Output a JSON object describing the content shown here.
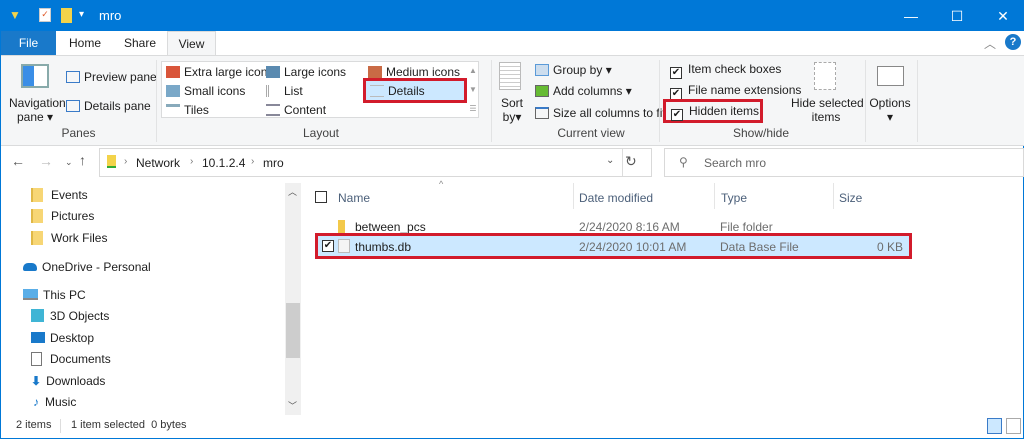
{
  "title": "mro",
  "window_buttons": {
    "minimize": "—",
    "maximize": "☐",
    "close": "✕"
  },
  "tabs": [
    "File",
    "Home",
    "Share",
    "View"
  ],
  "ribbon": {
    "panes": {
      "navigation_pane": "Navigation",
      "navigation_pane2": "pane",
      "preview_pane": "Preview pane",
      "details_pane": "Details pane",
      "group": "Panes"
    },
    "layout": {
      "items": [
        "Extra large icons",
        "Large icons",
        "Medium icons",
        "Small icons",
        "List",
        "Details",
        "Tiles",
        "Content"
      ],
      "selected": "Details",
      "group": "Layout"
    },
    "current_view": {
      "sort_by": "Sort",
      "sort_by2": "by",
      "group_by": "Group by",
      "add_columns": "Add columns",
      "size_columns": "Size all columns to fit",
      "group": "Current view"
    },
    "show_hide": {
      "item_check_boxes": "Item check boxes",
      "file_name_extensions": "File name extensions",
      "hidden_items": "Hidden items",
      "hide_selected": "Hide selected",
      "hide_selected2": "items",
      "group": "Show/hide",
      "checked": [
        true,
        true,
        true
      ]
    },
    "options": "Options"
  },
  "address": {
    "crumbs": [
      "Network",
      "10.1.2.4",
      "mro"
    ],
    "search_placeholder": "Search mro"
  },
  "nav": {
    "items": [
      "Events",
      "Pictures",
      "Work Files",
      "OneDrive - Personal",
      "This PC",
      "3D Objects",
      "Desktop",
      "Documents",
      "Downloads",
      "Music"
    ]
  },
  "columns": [
    "Name",
    "Date modified",
    "Type",
    "Size"
  ],
  "files": [
    {
      "name": "between_pcs",
      "date": "2/24/2020 8:16 AM",
      "type": "File folder",
      "size": "",
      "selected": false
    },
    {
      "name": "thumbs.db",
      "date": "2/24/2020 10:01 AM",
      "type": "Data Base File",
      "size": "0 KB",
      "selected": true
    }
  ],
  "status": {
    "count": "2 items",
    "selection": "1 item selected  0 bytes"
  },
  "colors": {
    "accent": "#0078d7",
    "highlight": "#cce8ff",
    "annotation": "#d21b2b"
  }
}
